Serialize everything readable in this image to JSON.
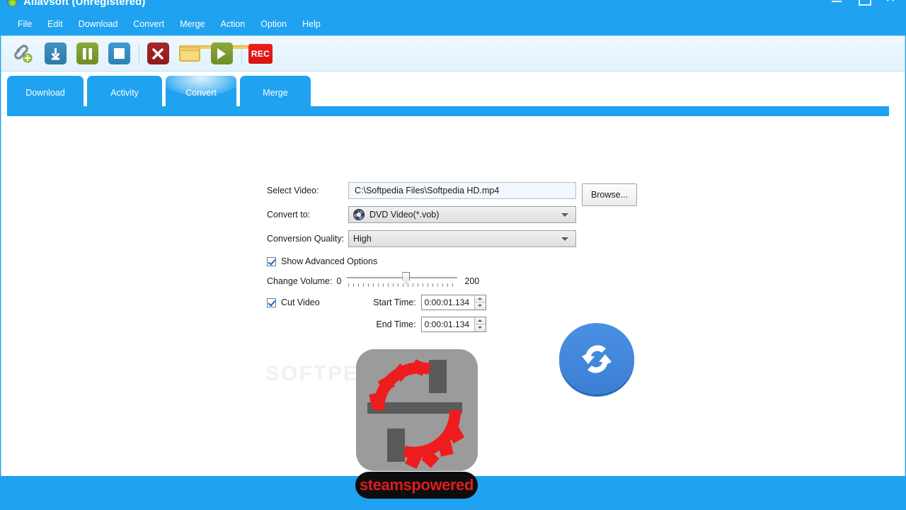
{
  "window": {
    "title": "Allavsoft (Unregistered)",
    "logo_icon": "allavsoft-logo-icon",
    "controls": {
      "minimize": "minimize-icon",
      "maximize": "maximize-icon",
      "close": "✕"
    }
  },
  "menu": {
    "items": [
      {
        "label": "File"
      },
      {
        "label": "Edit"
      },
      {
        "label": "Download"
      },
      {
        "label": "Convert"
      },
      {
        "label": "Merge"
      },
      {
        "label": "Action"
      },
      {
        "label": "Option"
      },
      {
        "label": "Help"
      }
    ]
  },
  "toolbar": {
    "buttons": [
      {
        "name": "add-link-button",
        "icon": "link-plus-icon",
        "label": ""
      },
      {
        "name": "download-button",
        "icon": "download-arrow-icon",
        "label": "⬇"
      },
      {
        "name": "pause-button",
        "icon": "pause-icon",
        "label": "▐▐"
      },
      {
        "name": "stop-button",
        "icon": "stop-square-icon",
        "label": "■"
      },
      {
        "name": "delete-button",
        "icon": "close-x-icon",
        "label": "✕"
      },
      {
        "name": "open-folder-button",
        "icon": "folder-icon",
        "label": ""
      },
      {
        "name": "play-button",
        "icon": "play-triangle-icon",
        "label": "▶"
      },
      {
        "name": "record-button",
        "icon": "rec-icon",
        "label": "REC"
      }
    ]
  },
  "tabs": {
    "items": [
      {
        "label": "Download",
        "active": false
      },
      {
        "label": "Activity",
        "active": false
      },
      {
        "label": "Convert",
        "active": true
      },
      {
        "label": "Merge",
        "active": false
      }
    ]
  },
  "form": {
    "select_video": {
      "label": "Select Video:",
      "value": "C:\\Softpedia Files\\Softpedia HD.mp4",
      "placeholder": ""
    },
    "browse_button": "Browse...",
    "convert_to": {
      "label": "Convert to:",
      "value": "DVD Video(*.vob)",
      "icon": "dvd-disc-icon"
    },
    "conversion_quality": {
      "label": "Conversion Quality:",
      "value": "High"
    },
    "show_advanced_options": {
      "label": "Show Advanced Options",
      "checked": true
    },
    "change_volume": {
      "label": "Change Volume:",
      "min": "0",
      "max": "200",
      "value": 100
    },
    "cut_video": {
      "label": "Cut Video",
      "checked": true,
      "start_time": {
        "label": "Start Time:",
        "value": "0:00:01.134"
      },
      "end_time": {
        "label": "End Time:",
        "value": "0:00:01.134"
      }
    }
  },
  "watermarks": {
    "softpedia": "SOFTPEDIA",
    "steamspowered": "steamspowered"
  },
  "decorations": {
    "gear_logo": "gear-settings-logo-icon",
    "sync_logo": "sync-convert-logo-icon"
  },
  "colors": {
    "brand_blue": "#1fa2f0",
    "toolbar_bg": "#e8f4fc",
    "field_bg": "#f2f8fd",
    "accent_red": "#e01b1b"
  }
}
